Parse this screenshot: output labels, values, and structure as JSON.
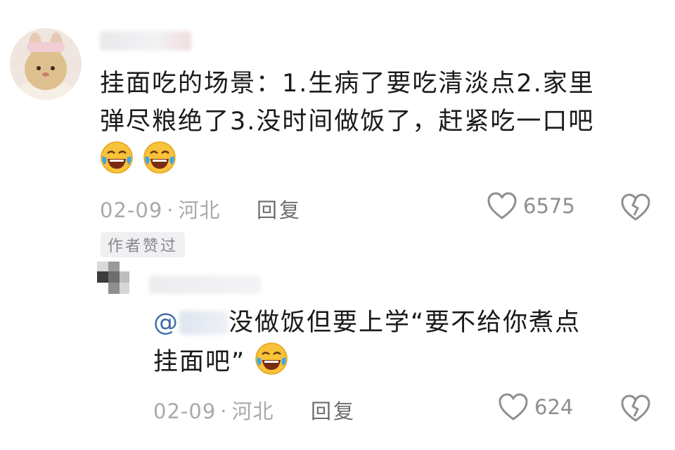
{
  "comment": {
    "text_line1": "挂面吃的场景：1.生病了要吃清淡点2.家里",
    "text_line2": "弹尽粮绝了3.没时间做饭了，赶紧吃一口吧",
    "emojis": [
      "laughing-crying-emoji",
      "laughing-crying-emoji"
    ],
    "date": "02-09",
    "location": "河北",
    "reply_label": "回复",
    "like_count": "6575",
    "author_badge": "作者赞过"
  },
  "reply": {
    "mention_prefix": "@",
    "text_line1": "没做饭但要上学“要不给你煮点",
    "text_line2": "挂面吧”",
    "date": "02-09",
    "location": "河北",
    "reply_label": "回复",
    "like_count": "624"
  },
  "colors": {
    "mention": "#3f6ea8",
    "meta": "#a9a9ae",
    "badge_bg": "#f0f0f2"
  },
  "icons": {
    "like": "heart-outline-icon",
    "dislike": "broken-heart-icon"
  }
}
